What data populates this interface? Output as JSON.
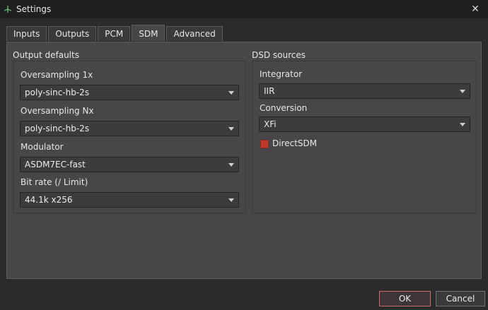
{
  "window": {
    "title": "Settings",
    "close_glyph": "✕"
  },
  "tabs": [
    {
      "label": "Inputs",
      "active": false
    },
    {
      "label": "Outputs",
      "active": false
    },
    {
      "label": "PCM",
      "active": false
    },
    {
      "label": "SDM",
      "active": true
    },
    {
      "label": "Advanced",
      "active": false
    }
  ],
  "output_defaults": {
    "title": "Output defaults",
    "oversampling_1x": {
      "label": "Oversampling 1x",
      "value": "poly-sinc-hb-2s"
    },
    "oversampling_nx": {
      "label": "Oversampling Nx",
      "value": "poly-sinc-hb-2s"
    },
    "modulator": {
      "label": "Modulator",
      "value": "ASDM7EC-fast"
    },
    "bit_rate": {
      "label": "Bit rate (/ Limit)",
      "value": "44.1k x256"
    }
  },
  "dsd_sources": {
    "title": "DSD sources",
    "integrator": {
      "label": "Integrator",
      "value": "IIR"
    },
    "conversion": {
      "label": "Conversion",
      "value": "XFi"
    },
    "direct_sdm": {
      "label": "DirectSDM",
      "checked": true
    }
  },
  "buttons": {
    "ok": "OK",
    "cancel": "Cancel"
  },
  "colors": {
    "accent_checkbox": "#c0392b",
    "ok_border": "#c86a6a"
  }
}
